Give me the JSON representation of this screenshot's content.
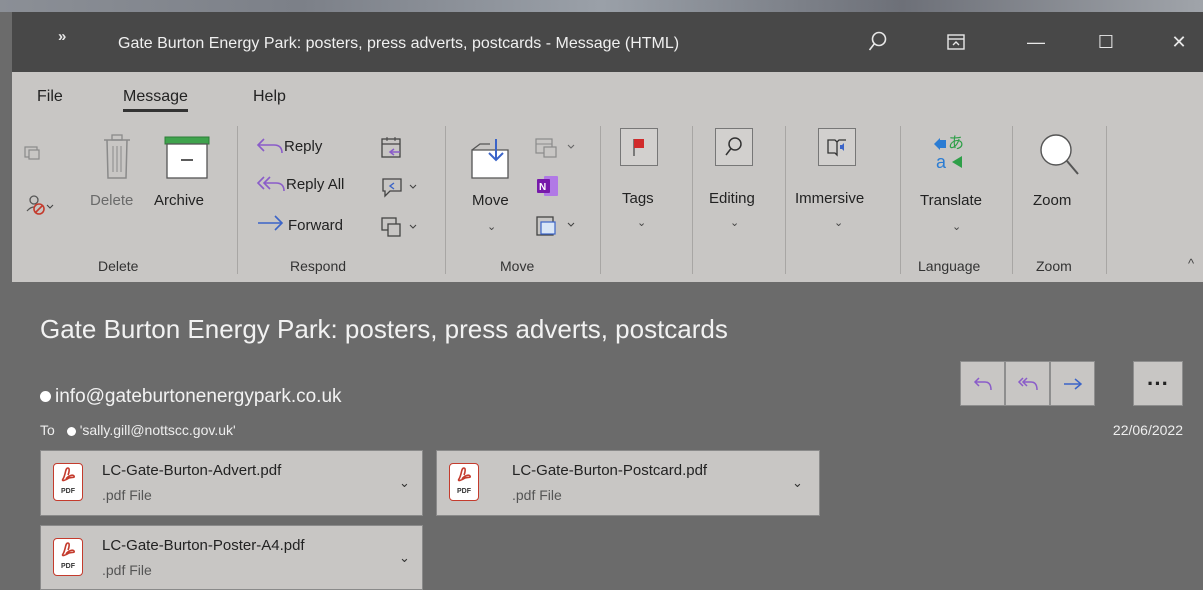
{
  "window": {
    "qa_label": "»",
    "title": "Gate Burton Energy Park: posters, press adverts, postcards  -  Message (HTML)",
    "search_glyph": "⚲",
    "minimize_glyph": "—",
    "maximize_glyph": "☐",
    "close_glyph": "✕"
  },
  "ribbon": {
    "tabs": [
      {
        "label": "File",
        "active": false
      },
      {
        "label": "Message",
        "active": true
      },
      {
        "label": "Help",
        "active": false
      }
    ],
    "groups": {
      "delete": {
        "label": "Delete",
        "delete_label": "Delete",
        "archive_label": "Archive"
      },
      "respond": {
        "label": "Respond",
        "reply_label": "Reply",
        "reply_all_label": "Reply All",
        "forward_label": "Forward"
      },
      "move": {
        "label": "Move",
        "move_label": "Move"
      },
      "tags": {
        "label": "Tags"
      },
      "editing": {
        "label": "Editing"
      },
      "immersive": {
        "label": "Immersive"
      },
      "language": {
        "label": "Language",
        "translate_label": "Translate"
      },
      "zoom": {
        "label": "Zoom",
        "zoom_label": "Zoom"
      }
    },
    "collapse_glyph": "^"
  },
  "message": {
    "subject": "Gate Burton Energy Park: posters, press adverts, postcards",
    "sender": "info@gateburtonenergypark.co.uk",
    "to_label": "To",
    "recipient": "'sally.gill@nottscc.gov.uk'",
    "date": "22/06/2022",
    "actions": {
      "reply_glyph": "↶",
      "reply_all_glyph": "↞",
      "forward_glyph": "→",
      "more_glyph": "···"
    }
  },
  "attachments": [
    {
      "name": "LC-Gate-Burton-Advert.pdf",
      "type": ".pdf File"
    },
    {
      "name": "LC-Gate-Burton-Postcard.pdf",
      "type": ".pdf File"
    },
    {
      "name": "LC-Gate-Burton-Poster-A4.pdf",
      "type": ".pdf File"
    }
  ],
  "pdf_badge": "PDF",
  "colors": {
    "titlebar": "#484848",
    "ribbon": "#c8c6c4",
    "reading_pane": "#6b6b6b",
    "accent_blue": "#3b64c8",
    "accent_purple": "#8a5cc9",
    "pdf_red": "#c43b2d"
  }
}
